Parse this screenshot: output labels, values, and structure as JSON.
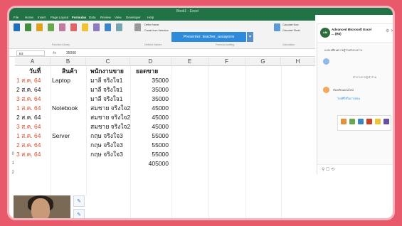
{
  "window": {
    "doc_title": "Book1 - Excel",
    "tabs": [
      "File",
      "Home",
      "Insert",
      "Page Layout",
      "Formulas",
      "Data",
      "Review",
      "View",
      "Developer",
      "Help"
    ]
  },
  "ribbon": {
    "groups": [
      "Function Library",
      "Defined Names",
      "Formula Auditing",
      "Calculation"
    ],
    "small_items": [
      "Define Name",
      "Create from Selection",
      "Calculate Now",
      "Calculate Sheet"
    ]
  },
  "presenter_banner": {
    "label": "Presenter: teacher_assayons"
  },
  "formula_bar": {
    "name_box": "B3",
    "fx": "fx",
    "value": "35000"
  },
  "sheet": {
    "columns": [
      "A",
      "B",
      "C",
      "D",
      "E",
      "F",
      "G",
      "H"
    ],
    "headers": {
      "date": "วันที่",
      "product": "สินค้า",
      "employee": "พนักงานขาย",
      "sales": "ยอดขาย"
    },
    "rows": [
      {
        "date": "1 ส.ค. 64",
        "date_color": "red",
        "product": "Laptop",
        "employee": "มาลี จริงใจ1",
        "sales": "35000"
      },
      {
        "date": "2 ส.ค. 64",
        "date_color": "black",
        "product": "",
        "employee": "มาลี จริงใจ1",
        "sales": "35000"
      },
      {
        "date": "3 ส.ค. 64",
        "date_color": "red",
        "product": "",
        "employee": "มาลี จริงใจ1",
        "sales": "35000"
      },
      {
        "date": "1 ส.ค. 64",
        "date_color": "red",
        "product": "Notebook",
        "employee": "สมชาย จริงใจ2",
        "sales": "45000"
      },
      {
        "date": "2 ส.ค. 64",
        "date_color": "black",
        "product": "",
        "employee": "สมชาย จริงใจ2",
        "sales": "45000"
      },
      {
        "date": "3 ส.ค. 64",
        "date_color": "red",
        "product": "",
        "employee": "สมชาย จริงใจ2",
        "sales": "45000"
      },
      {
        "date": "1 ส.ค. 64",
        "date_color": "red",
        "product": "Server",
        "employee": "กฤษ จริงใจ3",
        "sales": "55000"
      },
      {
        "date": "2 ส.ค. 64",
        "date_color": "red",
        "product": "",
        "employee": "กฤษ จริงใจ3",
        "sales": "55000"
      },
      {
        "date": "3 ส.ค. 64",
        "date_color": "red",
        "product": "",
        "employee": "กฤษ จริงใจ3",
        "sales": "55000"
      }
    ],
    "total": "405000",
    "row_numbers": [
      "",
      "",
      "",
      "",
      "",
      "",
      "",
      "",
      "",
      "",
      "0",
      "1",
      "2"
    ]
  },
  "side_panel": {
    "title": "Advanced Microsoft Excel ... (ตอ)",
    "lines": [
      "แลกเปลี่ยนความรู้ร่วมกับระหว่าง",
      "คำถามจากผู้เข้าร่วม",
      "ห้องเรียนออนไลน์",
      "ไฟล์ที่ใช้ในการสอน"
    ],
    "footer": "⚲ ☐ ⟲"
  },
  "colors": {
    "excel_green": "#217346",
    "accent_red": "#d9502d",
    "banner_blue": "#2e8bdb",
    "background_pink": "#e85a6b"
  }
}
